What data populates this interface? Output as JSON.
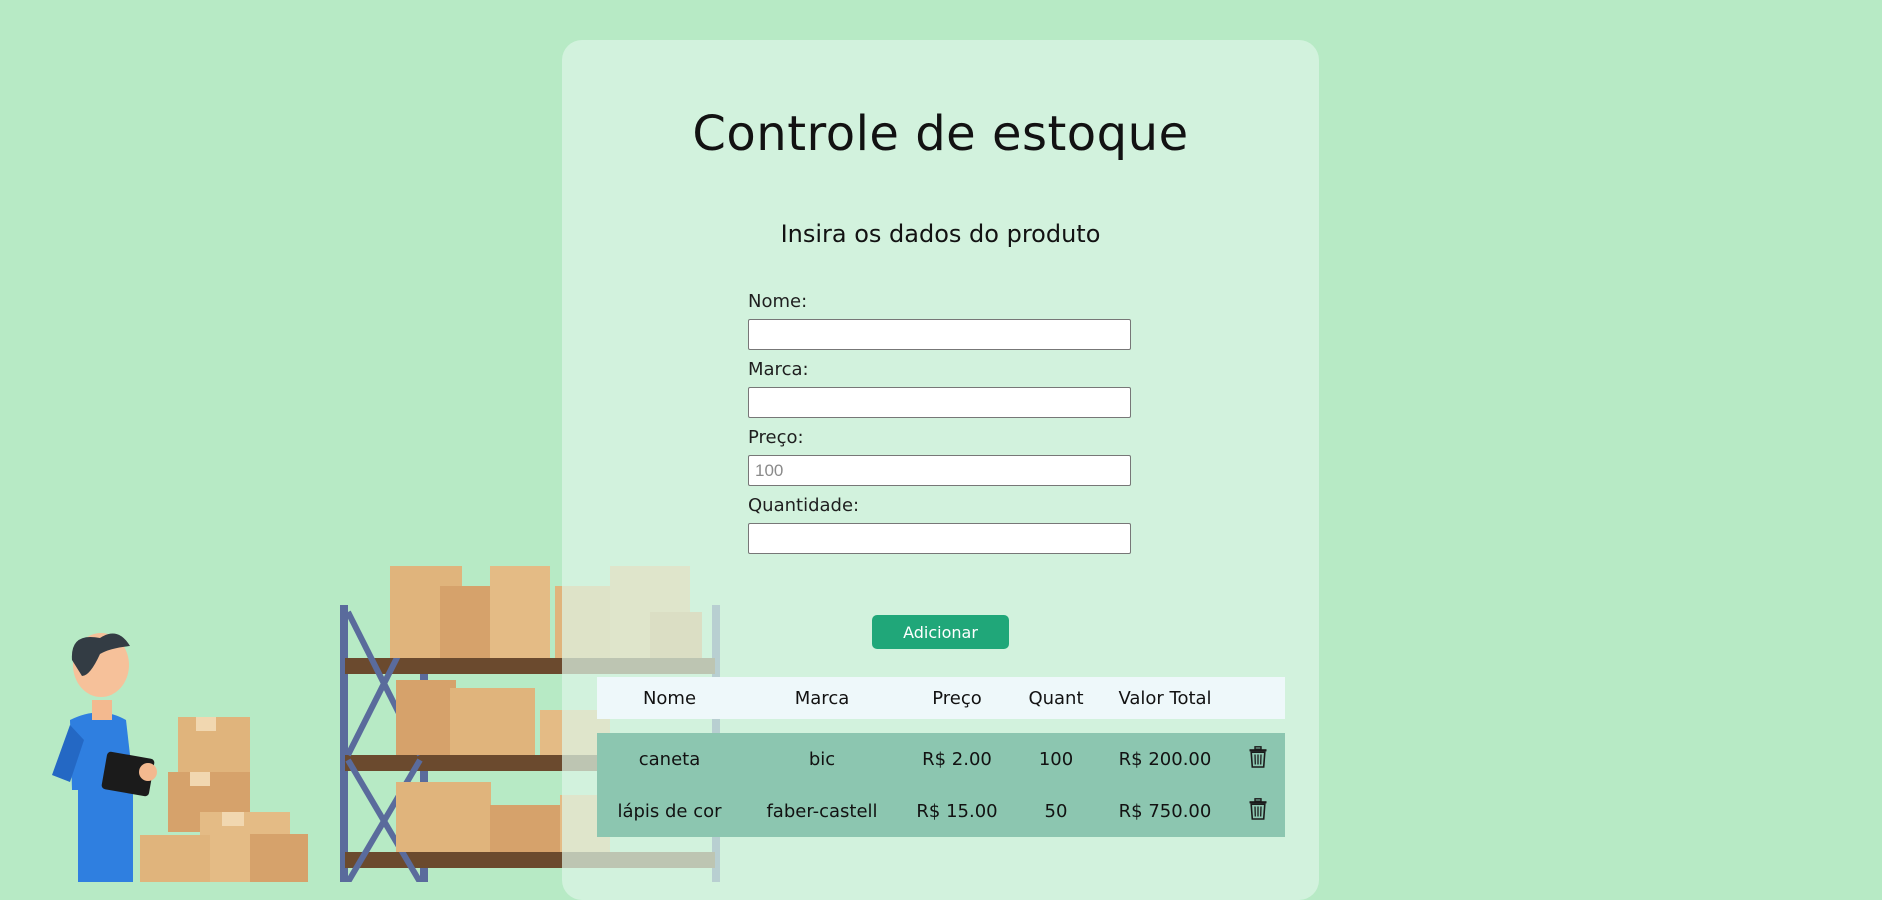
{
  "page": {
    "title": "Controle de estoque",
    "subtitle": "Insira os dados do produto"
  },
  "form": {
    "fields": [
      {
        "label": "Nome:",
        "value": "",
        "placeholder": ""
      },
      {
        "label": "Marca:",
        "value": "",
        "placeholder": ""
      },
      {
        "label": "Preço:",
        "value": "",
        "placeholder": "100"
      },
      {
        "label": "Quantidade:",
        "value": "",
        "placeholder": ""
      }
    ],
    "submit_label": "Adicionar"
  },
  "table": {
    "headers": [
      "Nome",
      "Marca",
      "Preço",
      "Quant",
      "Valor Total"
    ],
    "rows": [
      {
        "nome": "caneta",
        "marca": "bic",
        "preco": "R$ 2.00",
        "quant": "100",
        "total": "R$ 200.00",
        "action_icon": "trash-icon"
      },
      {
        "nome": "lápis de cor",
        "marca": "faber-castell",
        "preco": "R$ 15.00",
        "quant": "50",
        "total": "R$ 750.00",
        "action_icon": "trash-icon"
      }
    ]
  },
  "colors": {
    "background": "#b7eac5",
    "card": "#dcf5e6",
    "button": "#20a779",
    "table_header": "#eef8fa",
    "table_row": "#8cc6b0"
  }
}
